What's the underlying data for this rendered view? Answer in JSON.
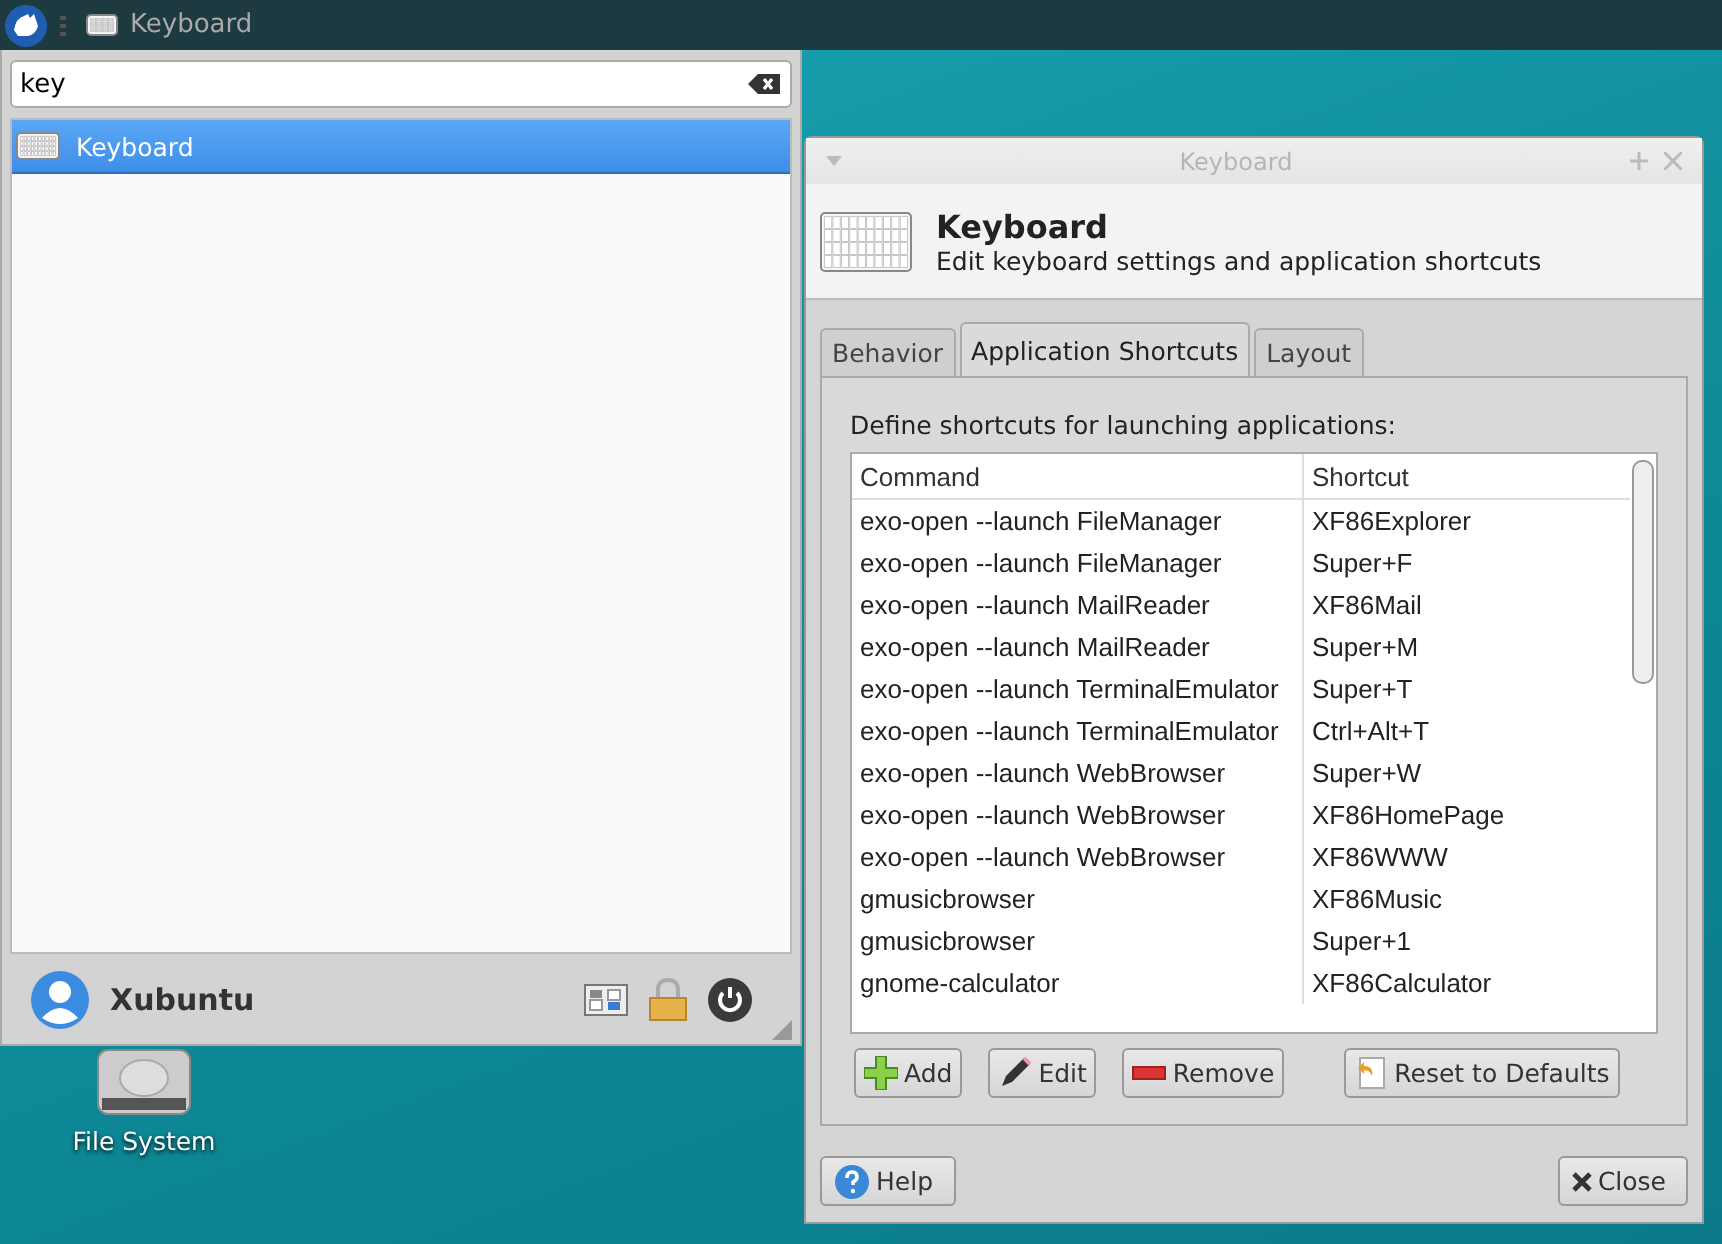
{
  "panel": {
    "window_button": "Keyboard"
  },
  "menu": {
    "search": {
      "value": "key"
    },
    "results": [
      {
        "label": "Keyboard",
        "selected": true
      }
    ],
    "user": "Xubuntu"
  },
  "desktop": {
    "icons": [
      {
        "label": "File System"
      }
    ]
  },
  "dialog": {
    "title": "Keyboard",
    "heading": "Keyboard",
    "subtitle": "Edit keyboard settings and application shortcuts",
    "tabs": [
      {
        "label": "Behavior",
        "selected": false
      },
      {
        "label": "Application Shortcuts",
        "selected": true
      },
      {
        "label": "Layout",
        "selected": false
      }
    ],
    "description": "Define shortcuts for launching applications:",
    "table": {
      "columns": [
        "Command",
        "Shortcut"
      ],
      "rows": [
        [
          "exo-open --launch FileManager",
          "XF86Explorer"
        ],
        [
          "exo-open --launch FileManager",
          "Super+F"
        ],
        [
          "exo-open --launch MailReader",
          "XF86Mail"
        ],
        [
          "exo-open --launch MailReader",
          "Super+M"
        ],
        [
          "exo-open --launch TerminalEmulator",
          "Super+T"
        ],
        [
          "exo-open --launch TerminalEmulator",
          "Ctrl+Alt+T"
        ],
        [
          "exo-open --launch WebBrowser",
          "Super+W"
        ],
        [
          "exo-open --launch WebBrowser",
          "XF86HomePage"
        ],
        [
          "exo-open --launch WebBrowser",
          "XF86WWW"
        ],
        [
          "gmusicbrowser",
          "XF86Music"
        ],
        [
          "gmusicbrowser",
          "Super+1"
        ],
        [
          "gnome-calculator",
          "XF86Calculator"
        ]
      ]
    },
    "actions": [
      {
        "kind": "add",
        "label": "Add"
      },
      {
        "kind": "edit",
        "label": "Edit"
      },
      {
        "kind": "remove",
        "label": "Remove"
      },
      {
        "kind": "reset",
        "label": "Reset to Defaults"
      }
    ],
    "help": "Help",
    "close": "Close"
  }
}
